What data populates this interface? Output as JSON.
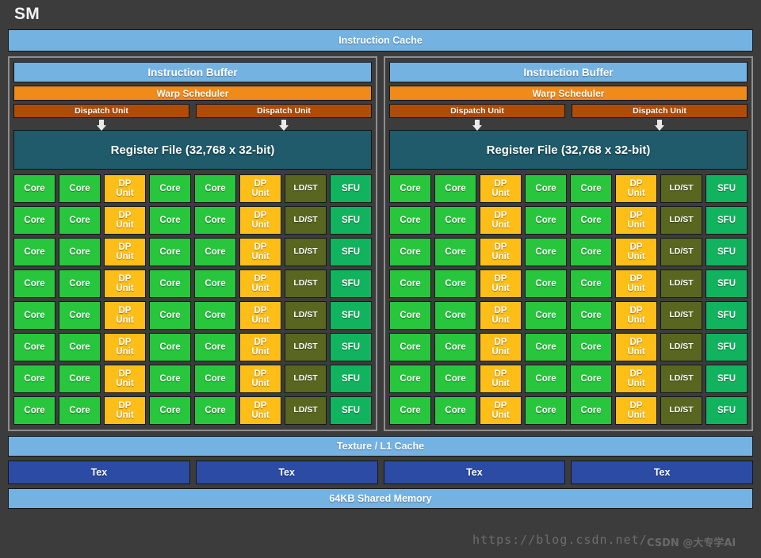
{
  "diagram": {
    "title": "SM",
    "instruction_cache": "Instruction Cache",
    "scheduler_block": {
      "instruction_buffer": "Instruction Buffer",
      "warp_scheduler": "Warp Scheduler",
      "dispatch_units": [
        "Dispatch Unit",
        "Dispatch Unit"
      ],
      "register_file": "Register File (32,768 x 32-bit)",
      "arrow_icon": "down-arrow-icon"
    },
    "core_grid": {
      "rows": 8,
      "columns": 8,
      "column_types": [
        "core",
        "core",
        "dp",
        "core",
        "core",
        "dp",
        "ldst",
        "sfu"
      ],
      "labels": {
        "core": "Core",
        "dp_line1": "DP",
        "dp_line2": "Unit",
        "ldst": "LD/ST",
        "sfu": "SFU"
      }
    },
    "memory": {
      "texture_l1_cache": "Texture / L1 Cache",
      "tex_units": [
        "Tex",
        "Tex",
        "Tex",
        "Tex"
      ],
      "shared_memory": "64KB Shared Memory"
    },
    "halves": 2,
    "colors": {
      "background": "#3c3c3c",
      "cache_blue": "#74b2e2",
      "warp_orange": "#f08a19",
      "dispatch_brown": "#ad4d09",
      "register_teal": "#1f5b6b",
      "core_green": "#27c63c",
      "dp_yellow": "#fdbe17",
      "ldst_olive": "#58661f",
      "sfu_green": "#12b35e",
      "tex_blue": "#2b4ba5",
      "half_border": "#8e8e8e"
    }
  },
  "watermark": {
    "url": "https://blog.csdn.net/",
    "brand": "CSDN @大专学AI"
  }
}
